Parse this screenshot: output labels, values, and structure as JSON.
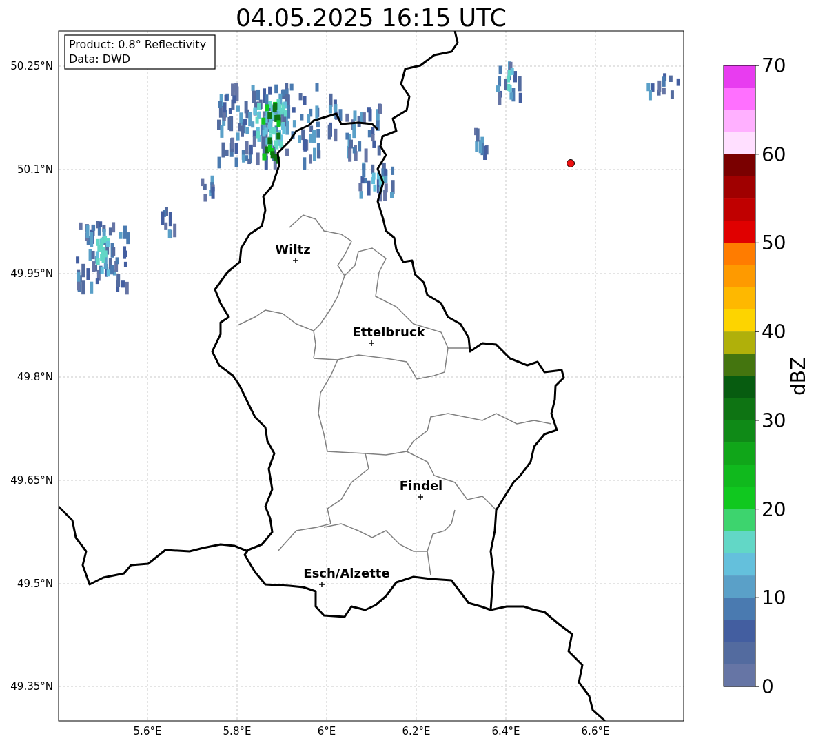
{
  "title": "04.05.2025 16:15 UTC",
  "info_box": {
    "lines": [
      "Product: 0.8° Reflectivity",
      "Data: DWD"
    ]
  },
  "cities": [
    {
      "name": "Wiltz"
    },
    {
      "name": "Ettelbruck"
    },
    {
      "name": "Findel"
    },
    {
      "name": "Esch/Alzette"
    }
  ],
  "lat_ticks": [
    "50.25°N",
    "50.1°N",
    "49.95°N",
    "49.8°N",
    "49.65°N",
    "49.5°N",
    "49.35°N"
  ],
  "lon_ticks": [
    "5.6°E",
    "5.8°E",
    "6°E",
    "6.2°E",
    "6.4°E",
    "6.6°E"
  ],
  "colorbar": {
    "label": "dBZ",
    "ticks": [
      "70",
      "60",
      "50",
      "40",
      "30",
      "20",
      "10",
      "0"
    ],
    "segments": [
      {
        "color": "#e83cf0"
      },
      {
        "color": "#ff70ff"
      },
      {
        "color": "#ffb0ff"
      },
      {
        "color": "#ffdfff"
      },
      {
        "color": "#7a0000"
      },
      {
        "color": "#a00000"
      },
      {
        "color": "#c00000"
      },
      {
        "color": "#e00000"
      },
      {
        "color": "#ff7c00"
      },
      {
        "color": "#fe9a00"
      },
      {
        "color": "#feb800"
      },
      {
        "color": "#fdd400"
      },
      {
        "color": "#b0b00a"
      },
      {
        "color": "#44750f"
      },
      {
        "color": "#075c10"
      },
      {
        "color": "#0e7413"
      },
      {
        "color": "#0f8a17"
      },
      {
        "color": "#10a619"
      },
      {
        "color": "#10b91d"
      },
      {
        "color": "#10c81f"
      },
      {
        "color": "#3dd46e"
      },
      {
        "color": "#62d7c6"
      },
      {
        "color": "#64c0dc"
      },
      {
        "color": "#5aa0c8"
      },
      {
        "color": "#4a7ab0"
      },
      {
        "color": "#435ea0"
      },
      {
        "color": "#536b9f"
      },
      {
        "color": "#6675a5"
      }
    ]
  }
}
